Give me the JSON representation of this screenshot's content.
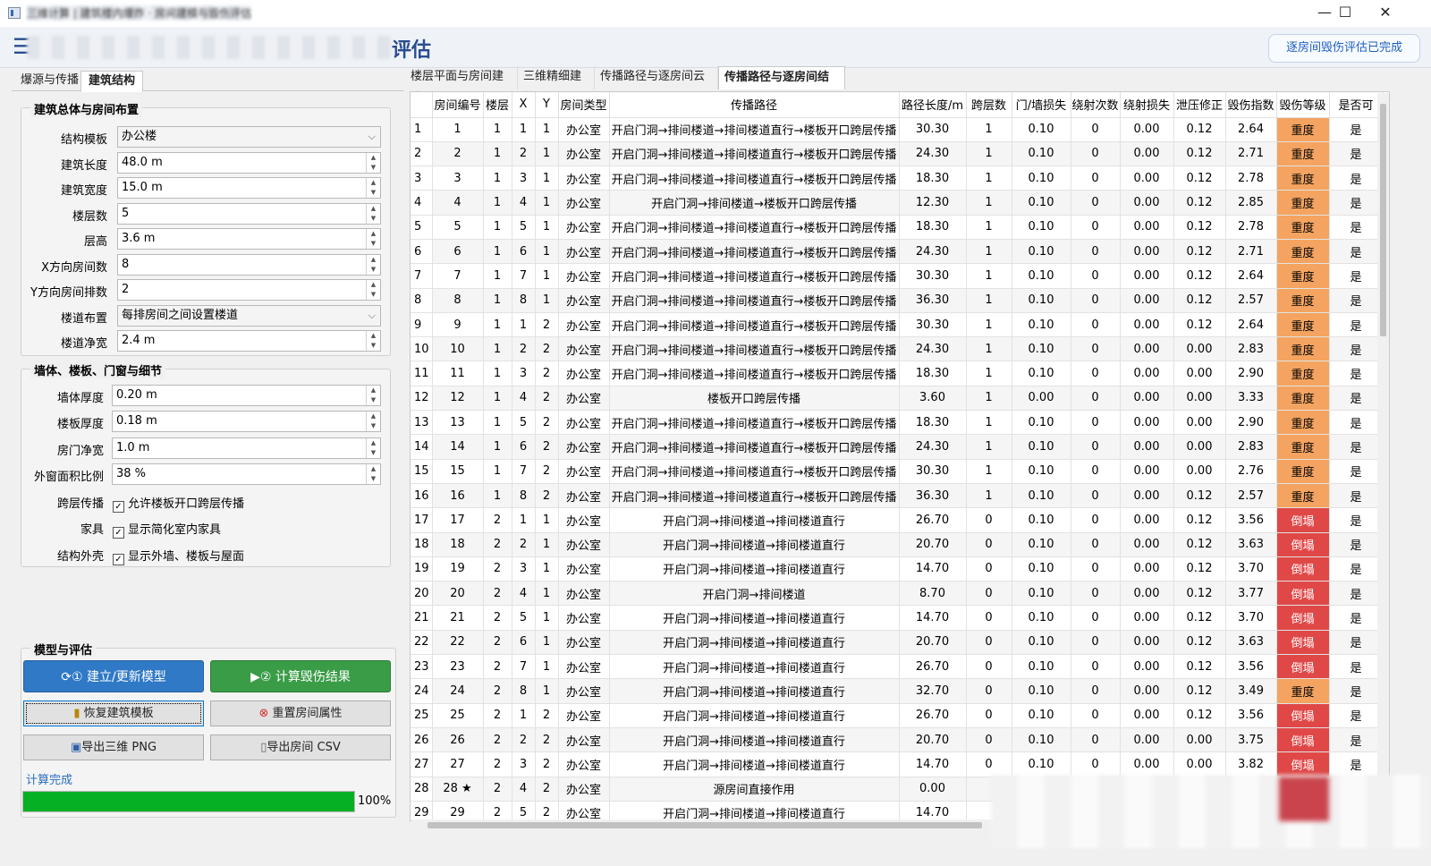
{
  "window": {
    "title": "三维计算 | 建筑楼内爆炸 · 房间建模与毁伤评估",
    "controls": {
      "minimize": "—",
      "maximize": "☐",
      "close": "✕"
    }
  },
  "header": {
    "menu_icon": "☰",
    "title": "评估",
    "status_button": "逐房间毁伤评估已完成"
  },
  "left_tabs": [
    "爆源与传播",
    "建筑结构"
  ],
  "group1": {
    "title": "建筑总体与房间布置",
    "fields": [
      {
        "label": "结构模板",
        "value": "办公楼",
        "kind": "combo"
      },
      {
        "label": "建筑长度",
        "value": "48.0 m",
        "kind": "spin"
      },
      {
        "label": "建筑宽度",
        "value": "15.0 m",
        "kind": "spin"
      },
      {
        "label": "楼层数",
        "value": "5",
        "kind": "spin"
      },
      {
        "label": "层高",
        "value": "3.6 m",
        "kind": "spin"
      },
      {
        "label": "X方向房间数",
        "value": "8",
        "kind": "spin"
      },
      {
        "label": "Y方向房间排数",
        "value": "2",
        "kind": "spin"
      },
      {
        "label": "楼道布置",
        "value": "每排房间之间设置楼道",
        "kind": "combo"
      },
      {
        "label": "楼道净宽",
        "value": "2.4 m",
        "kind": "spin"
      }
    ]
  },
  "group2": {
    "title": "墙体、楼板、门窗与细节",
    "fields": [
      {
        "label": "墙体厚度",
        "value": "0.20 m"
      },
      {
        "label": "楼板厚度",
        "value": "0.18 m"
      },
      {
        "label": "房门净宽",
        "value": "1.0 m"
      },
      {
        "label": "外窗面积比例",
        "value": "38 %"
      }
    ],
    "checks": [
      {
        "label": "跨层传播",
        "text": "允许楼板开口跨层传播",
        "checked": true
      },
      {
        "label": "家具",
        "text": "显示简化室内家具",
        "checked": true
      },
      {
        "label": "结构外壳",
        "text": "显示外墙、楼板与屋面",
        "checked": true
      }
    ]
  },
  "group3": {
    "title": "模型与评估",
    "build_button": "① 建立/更新模型",
    "compute_button": "② 计算毁伤结果",
    "restore_button": "恢复建筑模板",
    "reset_button": "重置房间属性",
    "export_png_button": "导出三维 PNG",
    "export_csv_button": "导出房间 CSV",
    "status": "计算完成",
    "progress": 100,
    "progress_text": "100%"
  },
  "right_tabs": [
    "楼层平面与房间建模",
    "三维精细建筑",
    "传播路径与逐房间云图",
    "传播路径与逐房间结果"
  ],
  "colors": {
    "heavy": "#f4a460",
    "collapse": "#e04848",
    "accent": "#2a4d8f",
    "progress": "#06b025"
  },
  "table": {
    "headers": [
      "房间编号",
      "楼层",
      "X",
      "Y",
      "房间类型",
      "传播路径",
      "路径长度/m",
      "跨层数",
      "门/墙损失",
      "绕射次数",
      "绕射损失",
      "泄压修正",
      "毁伤指数",
      "毁伤等级",
      "是否可"
    ],
    "rows": [
      [
        "1",
        "1",
        "1",
        "1",
        "1",
        "办公室",
        "开启门洞→排间楼道→排间楼道直行→楼板开口跨层传播",
        "30.30",
        "1",
        "0.10",
        "0",
        "0.00",
        "0.12",
        "2.64",
        "重度",
        "是"
      ],
      [
        "2",
        "2",
        "1",
        "2",
        "1",
        "办公室",
        "开启门洞→排间楼道→排间楼道直行→楼板开口跨层传播",
        "24.30",
        "1",
        "0.10",
        "0",
        "0.00",
        "0.12",
        "2.71",
        "重度",
        "是"
      ],
      [
        "3",
        "3",
        "1",
        "3",
        "1",
        "办公室",
        "开启门洞→排间楼道→排间楼道直行→楼板开口跨层传播",
        "18.30",
        "1",
        "0.10",
        "0",
        "0.00",
        "0.12",
        "2.78",
        "重度",
        "是"
      ],
      [
        "4",
        "4",
        "1",
        "4",
        "1",
        "办公室",
        "开启门洞→排间楼道→楼板开口跨层传播",
        "12.30",
        "1",
        "0.10",
        "0",
        "0.00",
        "0.12",
        "2.85",
        "重度",
        "是"
      ],
      [
        "5",
        "5",
        "1",
        "5",
        "1",
        "办公室",
        "开启门洞→排间楼道→排间楼道直行→楼板开口跨层传播",
        "18.30",
        "1",
        "0.10",
        "0",
        "0.00",
        "0.12",
        "2.78",
        "重度",
        "是"
      ],
      [
        "6",
        "6",
        "1",
        "6",
        "1",
        "办公室",
        "开启门洞→排间楼道→排间楼道直行→楼板开口跨层传播",
        "24.30",
        "1",
        "0.10",
        "0",
        "0.00",
        "0.12",
        "2.71",
        "重度",
        "是"
      ],
      [
        "7",
        "7",
        "1",
        "7",
        "1",
        "办公室",
        "开启门洞→排间楼道→排间楼道直行→楼板开口跨层传播",
        "30.30",
        "1",
        "0.10",
        "0",
        "0.00",
        "0.12",
        "2.64",
        "重度",
        "是"
      ],
      [
        "8",
        "8",
        "1",
        "8",
        "1",
        "办公室",
        "开启门洞→排间楼道→排间楼道直行→楼板开口跨层传播",
        "36.30",
        "1",
        "0.10",
        "0",
        "0.00",
        "0.12",
        "2.57",
        "重度",
        "是"
      ],
      [
        "9",
        "9",
        "1",
        "1",
        "2",
        "办公室",
        "开启门洞→排间楼道→排间楼道直行→楼板开口跨层传播",
        "30.30",
        "1",
        "0.10",
        "0",
        "0.00",
        "0.12",
        "2.64",
        "重度",
        "是"
      ],
      [
        "10",
        "10",
        "1",
        "2",
        "2",
        "办公室",
        "开启门洞→排间楼道→排间楼道直行→楼板开口跨层传播",
        "24.30",
        "1",
        "0.10",
        "0",
        "0.00",
        "0.00",
        "2.83",
        "重度",
        "是"
      ],
      [
        "11",
        "11",
        "1",
        "3",
        "2",
        "办公室",
        "开启门洞→排间楼道→排间楼道直行→楼板开口跨层传播",
        "18.30",
        "1",
        "0.10",
        "0",
        "0.00",
        "0.00",
        "2.90",
        "重度",
        "是"
      ],
      [
        "12",
        "12",
        "1",
        "4",
        "2",
        "办公室",
        "楼板开口跨层传播",
        "3.60",
        "1",
        "0.00",
        "0",
        "0.00",
        "0.00",
        "3.33",
        "重度",
        "是"
      ],
      [
        "13",
        "13",
        "1",
        "5",
        "2",
        "办公室",
        "开启门洞→排间楼道→排间楼道直行→楼板开口跨层传播",
        "18.30",
        "1",
        "0.10",
        "0",
        "0.00",
        "0.00",
        "2.90",
        "重度",
        "是"
      ],
      [
        "14",
        "14",
        "1",
        "6",
        "2",
        "办公室",
        "开启门洞→排间楼道→排间楼道直行→楼板开口跨层传播",
        "24.30",
        "1",
        "0.10",
        "0",
        "0.00",
        "0.00",
        "2.83",
        "重度",
        "是"
      ],
      [
        "15",
        "15",
        "1",
        "7",
        "2",
        "办公室",
        "开启门洞→排间楼道→排间楼道直行→楼板开口跨层传播",
        "30.30",
        "1",
        "0.10",
        "0",
        "0.00",
        "0.00",
        "2.76",
        "重度",
        "是"
      ],
      [
        "16",
        "16",
        "1",
        "8",
        "2",
        "办公室",
        "开启门洞→排间楼道→排间楼道直行→楼板开口跨层传播",
        "36.30",
        "1",
        "0.10",
        "0",
        "0.00",
        "0.12",
        "2.57",
        "重度",
        "是"
      ],
      [
        "17",
        "17",
        "2",
        "1",
        "1",
        "办公室",
        "开启门洞→排间楼道→排间楼道直行",
        "26.70",
        "0",
        "0.10",
        "0",
        "0.00",
        "0.12",
        "3.56",
        "倒塌",
        "是"
      ],
      [
        "18",
        "18",
        "2",
        "2",
        "1",
        "办公室",
        "开启门洞→排间楼道→排间楼道直行",
        "20.70",
        "0",
        "0.10",
        "0",
        "0.00",
        "0.12",
        "3.63",
        "倒塌",
        "是"
      ],
      [
        "19",
        "19",
        "2",
        "3",
        "1",
        "办公室",
        "开启门洞→排间楼道→排间楼道直行",
        "14.70",
        "0",
        "0.10",
        "0",
        "0.00",
        "0.12",
        "3.70",
        "倒塌",
        "是"
      ],
      [
        "20",
        "20",
        "2",
        "4",
        "1",
        "办公室",
        "开启门洞→排间楼道",
        "8.70",
        "0",
        "0.10",
        "0",
        "0.00",
        "0.12",
        "3.77",
        "倒塌",
        "是"
      ],
      [
        "21",
        "21",
        "2",
        "5",
        "1",
        "办公室",
        "开启门洞→排间楼道→排间楼道直行",
        "14.70",
        "0",
        "0.10",
        "0",
        "0.00",
        "0.12",
        "3.70",
        "倒塌",
        "是"
      ],
      [
        "22",
        "22",
        "2",
        "6",
        "1",
        "办公室",
        "开启门洞→排间楼道→排间楼道直行",
        "20.70",
        "0",
        "0.10",
        "0",
        "0.00",
        "0.12",
        "3.63",
        "倒塌",
        "是"
      ],
      [
        "23",
        "23",
        "2",
        "7",
        "1",
        "办公室",
        "开启门洞→排间楼道→排间楼道直行",
        "26.70",
        "0",
        "0.10",
        "0",
        "0.00",
        "0.12",
        "3.56",
        "倒塌",
        "是"
      ],
      [
        "24",
        "24",
        "2",
        "8",
        "1",
        "办公室",
        "开启门洞→排间楼道→排间楼道直行",
        "32.70",
        "0",
        "0.10",
        "0",
        "0.00",
        "0.12",
        "3.49",
        "重度",
        "是"
      ],
      [
        "25",
        "25",
        "2",
        "1",
        "2",
        "办公室",
        "开启门洞→排间楼道→排间楼道直行",
        "26.70",
        "0",
        "0.10",
        "0",
        "0.00",
        "0.12",
        "3.56",
        "倒塌",
        "是"
      ],
      [
        "26",
        "26",
        "2",
        "2",
        "2",
        "办公室",
        "开启门洞→排间楼道→排间楼道直行",
        "20.70",
        "0",
        "0.10",
        "0",
        "0.00",
        "0.00",
        "3.75",
        "倒塌",
        "是"
      ],
      [
        "27",
        "27",
        "2",
        "3",
        "2",
        "办公室",
        "开启门洞→排间楼道→排间楼道直行",
        "14.70",
        "0",
        "0.10",
        "0",
        "0.00",
        "0.00",
        "3.82",
        "倒塌",
        "是"
      ],
      [
        "28",
        "28 ★",
        "2",
        "4",
        "2",
        "办公室",
        "源房间直接作用",
        "0.00",
        "",
        "",
        "",
        "",
        "",
        "",
        "",
        ""
      ],
      [
        "29",
        "29",
        "2",
        "5",
        "2",
        "办公室",
        "开启门洞→排间楼道→排间楼道直行",
        "14.70",
        "",
        "",
        "",
        "",
        "",
        "",
        "",
        ""
      ]
    ]
  }
}
